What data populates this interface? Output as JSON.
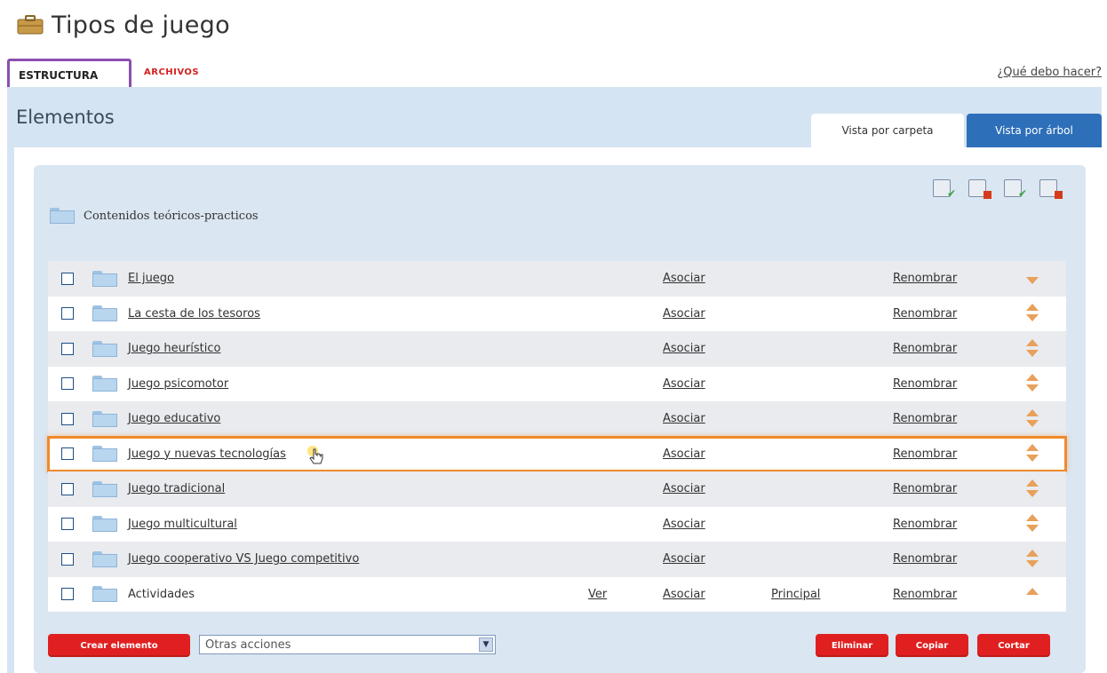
{
  "page": {
    "title": "Tipos de juego",
    "tabs": {
      "estructura": "ESTRUCTURA",
      "archivos": "ARCHIVOS"
    },
    "help_link": "¿Qué debo hacer?"
  },
  "panel": {
    "title": "Elementos",
    "view_tabs": {
      "folder": "Vista por carpeta",
      "tree": "Vista por árbol"
    },
    "root_folder": "Contenidos teóricos-practicos"
  },
  "rows": [
    {
      "name": "El juego",
      "asociar": "Asociar",
      "renombrar": "Renombrar"
    },
    {
      "name": "La cesta de los tesoros",
      "asociar": "Asociar",
      "renombrar": "Renombrar"
    },
    {
      "name": "Juego heurístico",
      "asociar": "Asociar",
      "renombrar": "Renombrar"
    },
    {
      "name": "Juego psicomotor",
      "asociar": "Asociar",
      "renombrar": "Renombrar"
    },
    {
      "name": "Juego educativo",
      "asociar": "Asociar",
      "renombrar": "Renombrar"
    },
    {
      "name": "Juego y nuevas tecnologías",
      "asociar": "Asociar",
      "renombrar": "Renombrar"
    },
    {
      "name": "Juego tradicional",
      "asociar": "Asociar",
      "renombrar": "Renombrar"
    },
    {
      "name": "Juego multicultural",
      "asociar": "Asociar",
      "renombrar": "Renombrar"
    },
    {
      "name": "Juego cooperativo VS Juego competitivo",
      "asociar": "Asociar",
      "renombrar": "Renombrar"
    },
    {
      "name": "Actividades",
      "ver": "Ver",
      "asociar": "Asociar",
      "principal": "Principal",
      "renombrar": "Renombrar"
    }
  ],
  "bottom": {
    "create_label": "Crear elemento",
    "other_actions": "Otras acciones",
    "eliminar_label": "Eliminar",
    "copiar_label": "Copiar",
    "cortar_label": "Cortar"
  },
  "colors": {
    "accent_blue": "#2d6fb8",
    "button_red": "#e02020",
    "highlight_orange": "#f08a2a",
    "tab_outline_purple": "#8a4fb0"
  },
  "icons": [
    "folder-icon",
    "add-document-icon",
    "delete-document-icon",
    "add-item-icon",
    "delete-item-icon",
    "sort-arrows-icon",
    "hand-cursor-icon"
  ]
}
